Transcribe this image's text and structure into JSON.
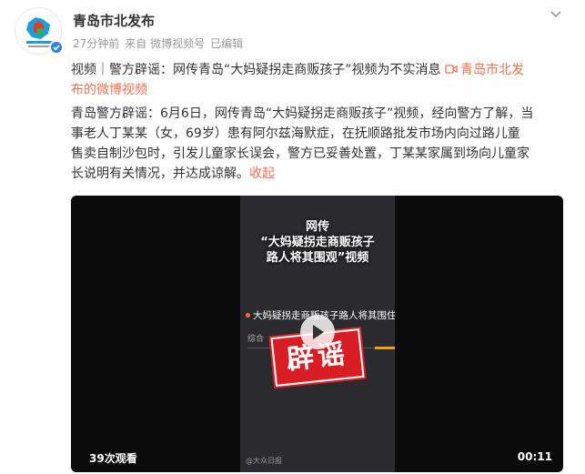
{
  "post": {
    "author": "青岛市北发布",
    "meta": {
      "time": "27分钟前",
      "source": "来自 微博视频号",
      "edited": "已编辑"
    },
    "text": {
      "line1_a": "视频｜警方辟谣：网传青岛“大妈疑拐走商贩孩子”视频为不实消息 ",
      "line1_link": "青岛市北发",
      "line2_link": "布的微博视频",
      "line3": "青岛警方辟谣：6月6日，网传青岛“大妈疑拐走商贩孩子”视频，经向警方了解，当",
      "line4": "事老人丁某某（女，69岁）患有阿尔兹海默症，在抚顺路批发市场内向过路儿童",
      "line5": "售卖自制沙包时，引发儿童家长误会，警方已妥善处置，丁某某家属到场向儿童家",
      "line6": "长说明有关情况，并达成谅解。",
      "collapse": "收起"
    },
    "video": {
      "frame_title_1": "网传",
      "frame_title_2": "“大妈疑拐走商贩孩子",
      "frame_title_3": "路人将其围观”视频",
      "frame_subtitle": "大妈疑拐走商贩孩子路人将其围住",
      "frame_tab": "综合",
      "stamp": "辟谣",
      "frame_watermark": "@大众日报",
      "views": "39次观看",
      "duration": "00:11"
    },
    "icons": {
      "avatar": "qingdao-shibei-logo",
      "verified": "verified-badge-icon",
      "more": "chevron-down-icon",
      "video_link": "video-camera-icon",
      "play": "play-icon"
    },
    "colors": {
      "link": "#eb7350",
      "verified": "#2c7fe8",
      "stamp": "#d81e24"
    }
  }
}
